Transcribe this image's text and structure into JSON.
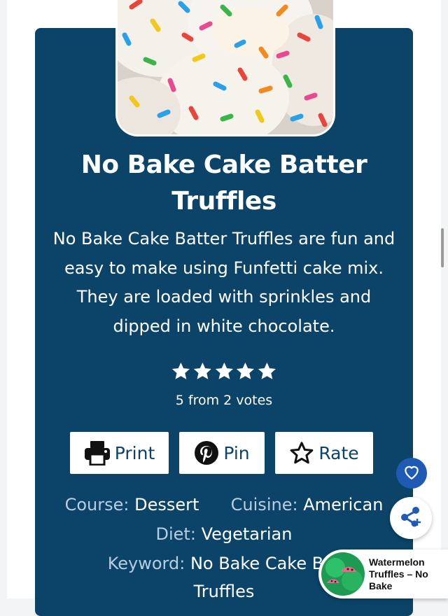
{
  "recipe": {
    "title_line1": "No Bake Cake Batter",
    "title_line2": "Truffles",
    "summary_lines": [
      "No Bake Cake Batter Truffles are fun and",
      "easy to make using Funfetti cake mix.",
      "They are loaded with sprinkles and",
      "dipped in white chocolate."
    ],
    "rating": {
      "stars": 5,
      "max": 5,
      "votes_text": "5 from 2 votes"
    },
    "buttons": {
      "print": {
        "label": "Print",
        "icon": "printer-icon"
      },
      "pin": {
        "label": "Pin",
        "icon": "pinterest-icon"
      },
      "rate": {
        "label": "Rate",
        "icon": "star-outline-icon"
      }
    },
    "meta": {
      "course_label": "Course:",
      "course_value": "Dessert",
      "cuisine_label": "Cuisine:",
      "cuisine_value": "American",
      "diet_label": "Diet:",
      "diet_value": "Vegetarian",
      "keyword_label": "Keyword:",
      "keyword_value_line1": "No Bake Cake Bat",
      "keyword_value_line2": "Truffles"
    }
  },
  "floating": {
    "heart_icon": "heart-icon",
    "share_icon": "share-icon",
    "related_popup": {
      "line1": "Watermelon",
      "line2": "Truffles – No",
      "line3": "Bake"
    }
  },
  "colors": {
    "card_bg": "#0b4468",
    "label_text": "#b8cde0",
    "heart_button": "#1f5bb5",
    "share_accent": "#1f5bb5"
  }
}
